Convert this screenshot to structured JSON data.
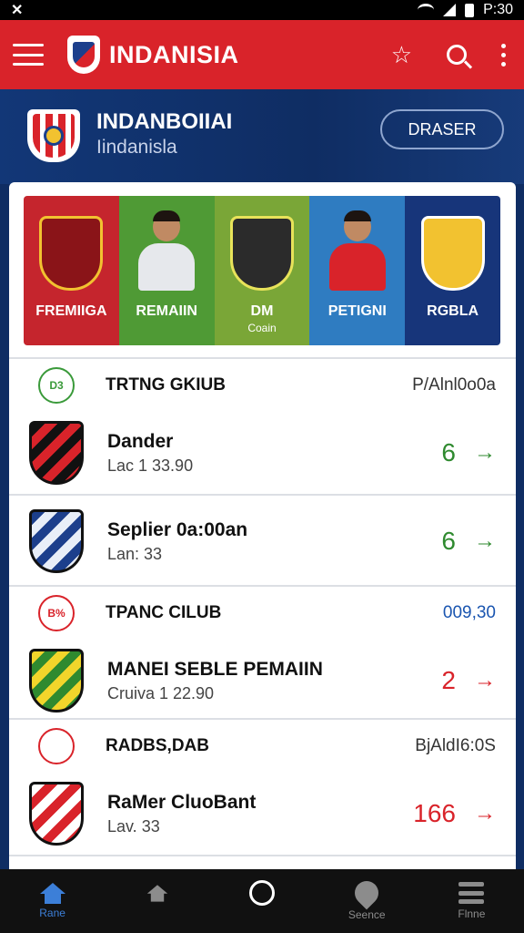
{
  "status_bar": {
    "left_icon": "x-icon",
    "time": "P:30"
  },
  "app_bar": {
    "title": "INDANISIA"
  },
  "hero": {
    "title": "INDANBOIIAI",
    "subtitle": "Iindanisla",
    "button_label": "DRASER"
  },
  "categories": [
    {
      "label": "FREMIIGA",
      "sub": "",
      "color": "#c5252d"
    },
    {
      "label": "REMAIIN",
      "sub": "",
      "color": "#4f9a35"
    },
    {
      "label": "DM",
      "sub": "Coain",
      "color": "#7aa637"
    },
    {
      "label": "PETIGNI",
      "sub": "",
      "color": "#2f7cc1"
    },
    {
      "label": "RGBLA",
      "sub": "",
      "color": "#17357a"
    }
  ],
  "sections": [
    {
      "title": "TRTNG GKIUB",
      "meta": "P/Alnl0o0a",
      "meta_color": "#333333",
      "icon_text": "D3",
      "icon_color": "#3a9a3a",
      "rows": [
        {
          "name": "Dander",
          "sub": "Lac 1 33.90",
          "count": "6",
          "color": "#2f8a2f",
          "crest": [
            "#111111",
            "#d9232a"
          ]
        },
        {
          "name": "Seplier 0a:00an",
          "sub": "Lan: 33",
          "count": "6",
          "color": "#2f8a2f",
          "crest": [
            "#1c3f8c",
            "#e8eef8"
          ]
        }
      ]
    },
    {
      "title": "TPANC CILUB",
      "meta": "009,30",
      "meta_color": "#1a55b0",
      "icon_text": "B%",
      "icon_color": "#d9232a",
      "rows": [
        {
          "name": "MANEI SEBLE PEMAIIN",
          "sub": "Cruiva 1 22.90",
          "count": "2",
          "color": "#d9232a",
          "crest": [
            "#f2d52b",
            "#2f8a2f"
          ]
        }
      ]
    },
    {
      "title": "RADBS,DAB",
      "meta": "BjAldI6:0S",
      "meta_color": "#333333",
      "icon_text": "",
      "icon_color": "#d9232a",
      "rows": [
        {
          "name": "RaMer CluoBant",
          "sub": "Lav. 33",
          "count": "166",
          "color": "#d9232a",
          "crest": [
            "#ffffff",
            "#d9232a"
          ]
        }
      ]
    }
  ],
  "bottom_nav": [
    {
      "label": "Rane",
      "icon": "home-icon",
      "active": true
    },
    {
      "label": "",
      "icon": "stadium-icon",
      "active": false
    },
    {
      "label": "",
      "icon": "circle-icon",
      "active": false
    },
    {
      "label": "Seence",
      "icon": "location-icon",
      "active": false
    },
    {
      "label": "Flnne",
      "icon": "menu-icon",
      "active": false
    }
  ]
}
